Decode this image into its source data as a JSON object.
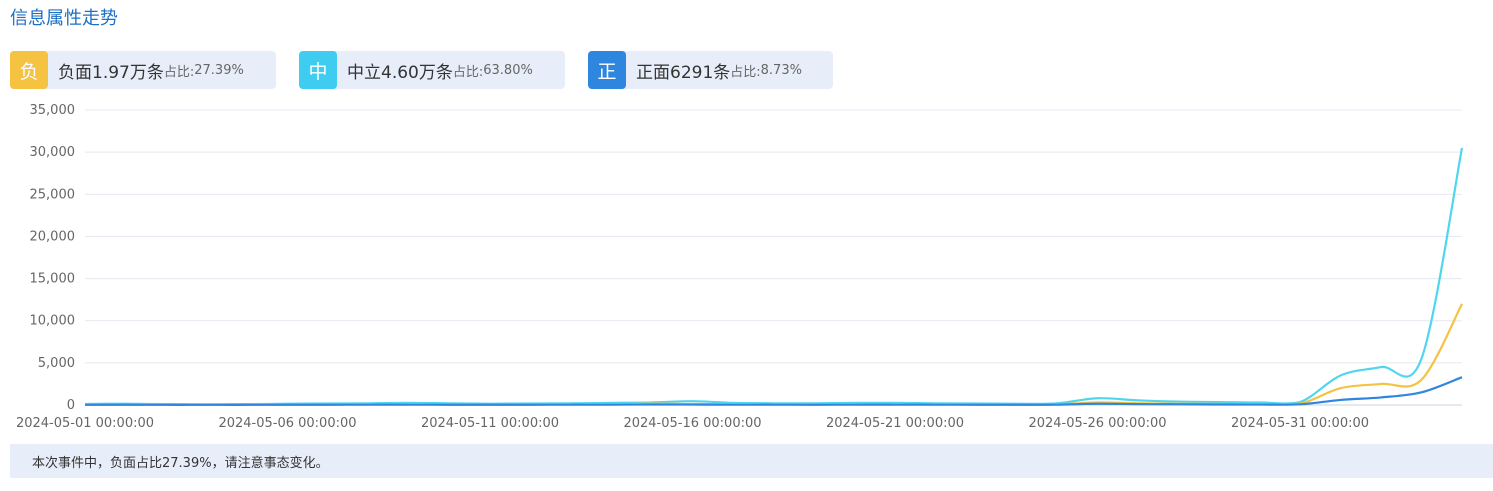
{
  "title": "信息属性走势",
  "stats": [
    {
      "badge": "负",
      "main": "负面1.97万条",
      "label": "占比:",
      "pct": "27.39%",
      "color": "#f5c242"
    },
    {
      "badge": "中",
      "main": "中立4.60万条",
      "label": "占比:",
      "pct": "63.80%",
      "color": "#3ecdf0"
    },
    {
      "badge": "正",
      "main": "正面6291条",
      "label": "占比:",
      "pct": "8.73%",
      "color": "#2e86de"
    }
  ],
  "footer_text": "本次事件中，负面占比27.39%，请注意事态变化。",
  "chart_data": {
    "type": "line",
    "ylim": [
      0,
      35000
    ],
    "yticks": [
      "0",
      "5,000",
      "10,000",
      "15,000",
      "20,000",
      "25,000",
      "30,000",
      "35,000"
    ],
    "xtick_labels": [
      "2024-05-01 00:00:00",
      "2024-05-06 00:00:00",
      "2024-05-11 00:00:00",
      "2024-05-16 00:00:00",
      "2024-05-21 00:00:00",
      "2024-05-26 00:00:00",
      "2024-05-31 00:00:00"
    ],
    "x": [
      "2024-05-01",
      "2024-05-02",
      "2024-05-03",
      "2024-05-04",
      "2024-05-05",
      "2024-05-06",
      "2024-05-07",
      "2024-05-08",
      "2024-05-09",
      "2024-05-10",
      "2024-05-11",
      "2024-05-12",
      "2024-05-13",
      "2024-05-14",
      "2024-05-15",
      "2024-05-16",
      "2024-05-17",
      "2024-05-18",
      "2024-05-19",
      "2024-05-20",
      "2024-05-21",
      "2024-05-22",
      "2024-05-23",
      "2024-05-24",
      "2024-05-25",
      "2024-05-26",
      "2024-05-27",
      "2024-05-28",
      "2024-05-29",
      "2024-05-30",
      "2024-05-31",
      "2024-06-01",
      "2024-06-02",
      "2024-06-03",
      "2024-06-04"
    ],
    "grid": true,
    "series": [
      {
        "name": "负面",
        "color": "#f5c242",
        "values": [
          40,
          50,
          40,
          30,
          40,
          50,
          60,
          70,
          80,
          60,
          50,
          60,
          70,
          80,
          150,
          120,
          90,
          80,
          70,
          80,
          90,
          80,
          70,
          60,
          80,
          300,
          200,
          150,
          120,
          100,
          150,
          2000,
          2500,
          3000,
          12000
        ]
      },
      {
        "name": "中立",
        "color": "#4fd6ef",
        "values": [
          120,
          150,
          100,
          80,
          100,
          150,
          180,
          200,
          250,
          200,
          150,
          180,
          200,
          250,
          300,
          450,
          250,
          200,
          200,
          250,
          250,
          200,
          180,
          150,
          200,
          800,
          550,
          400,
          350,
          300,
          350,
          3500,
          4500,
          5500,
          30500
        ]
      },
      {
        "name": "正面",
        "color": "#2e86de",
        "values": [
          20,
          30,
          20,
          20,
          20,
          30,
          30,
          40,
          40,
          30,
          30,
          30,
          40,
          40,
          60,
          50,
          40,
          40,
          30,
          40,
          40,
          40,
          30,
          30,
          40,
          150,
          100,
          80,
          60,
          50,
          80,
          600,
          900,
          1500,
          3300
        ]
      }
    ]
  }
}
